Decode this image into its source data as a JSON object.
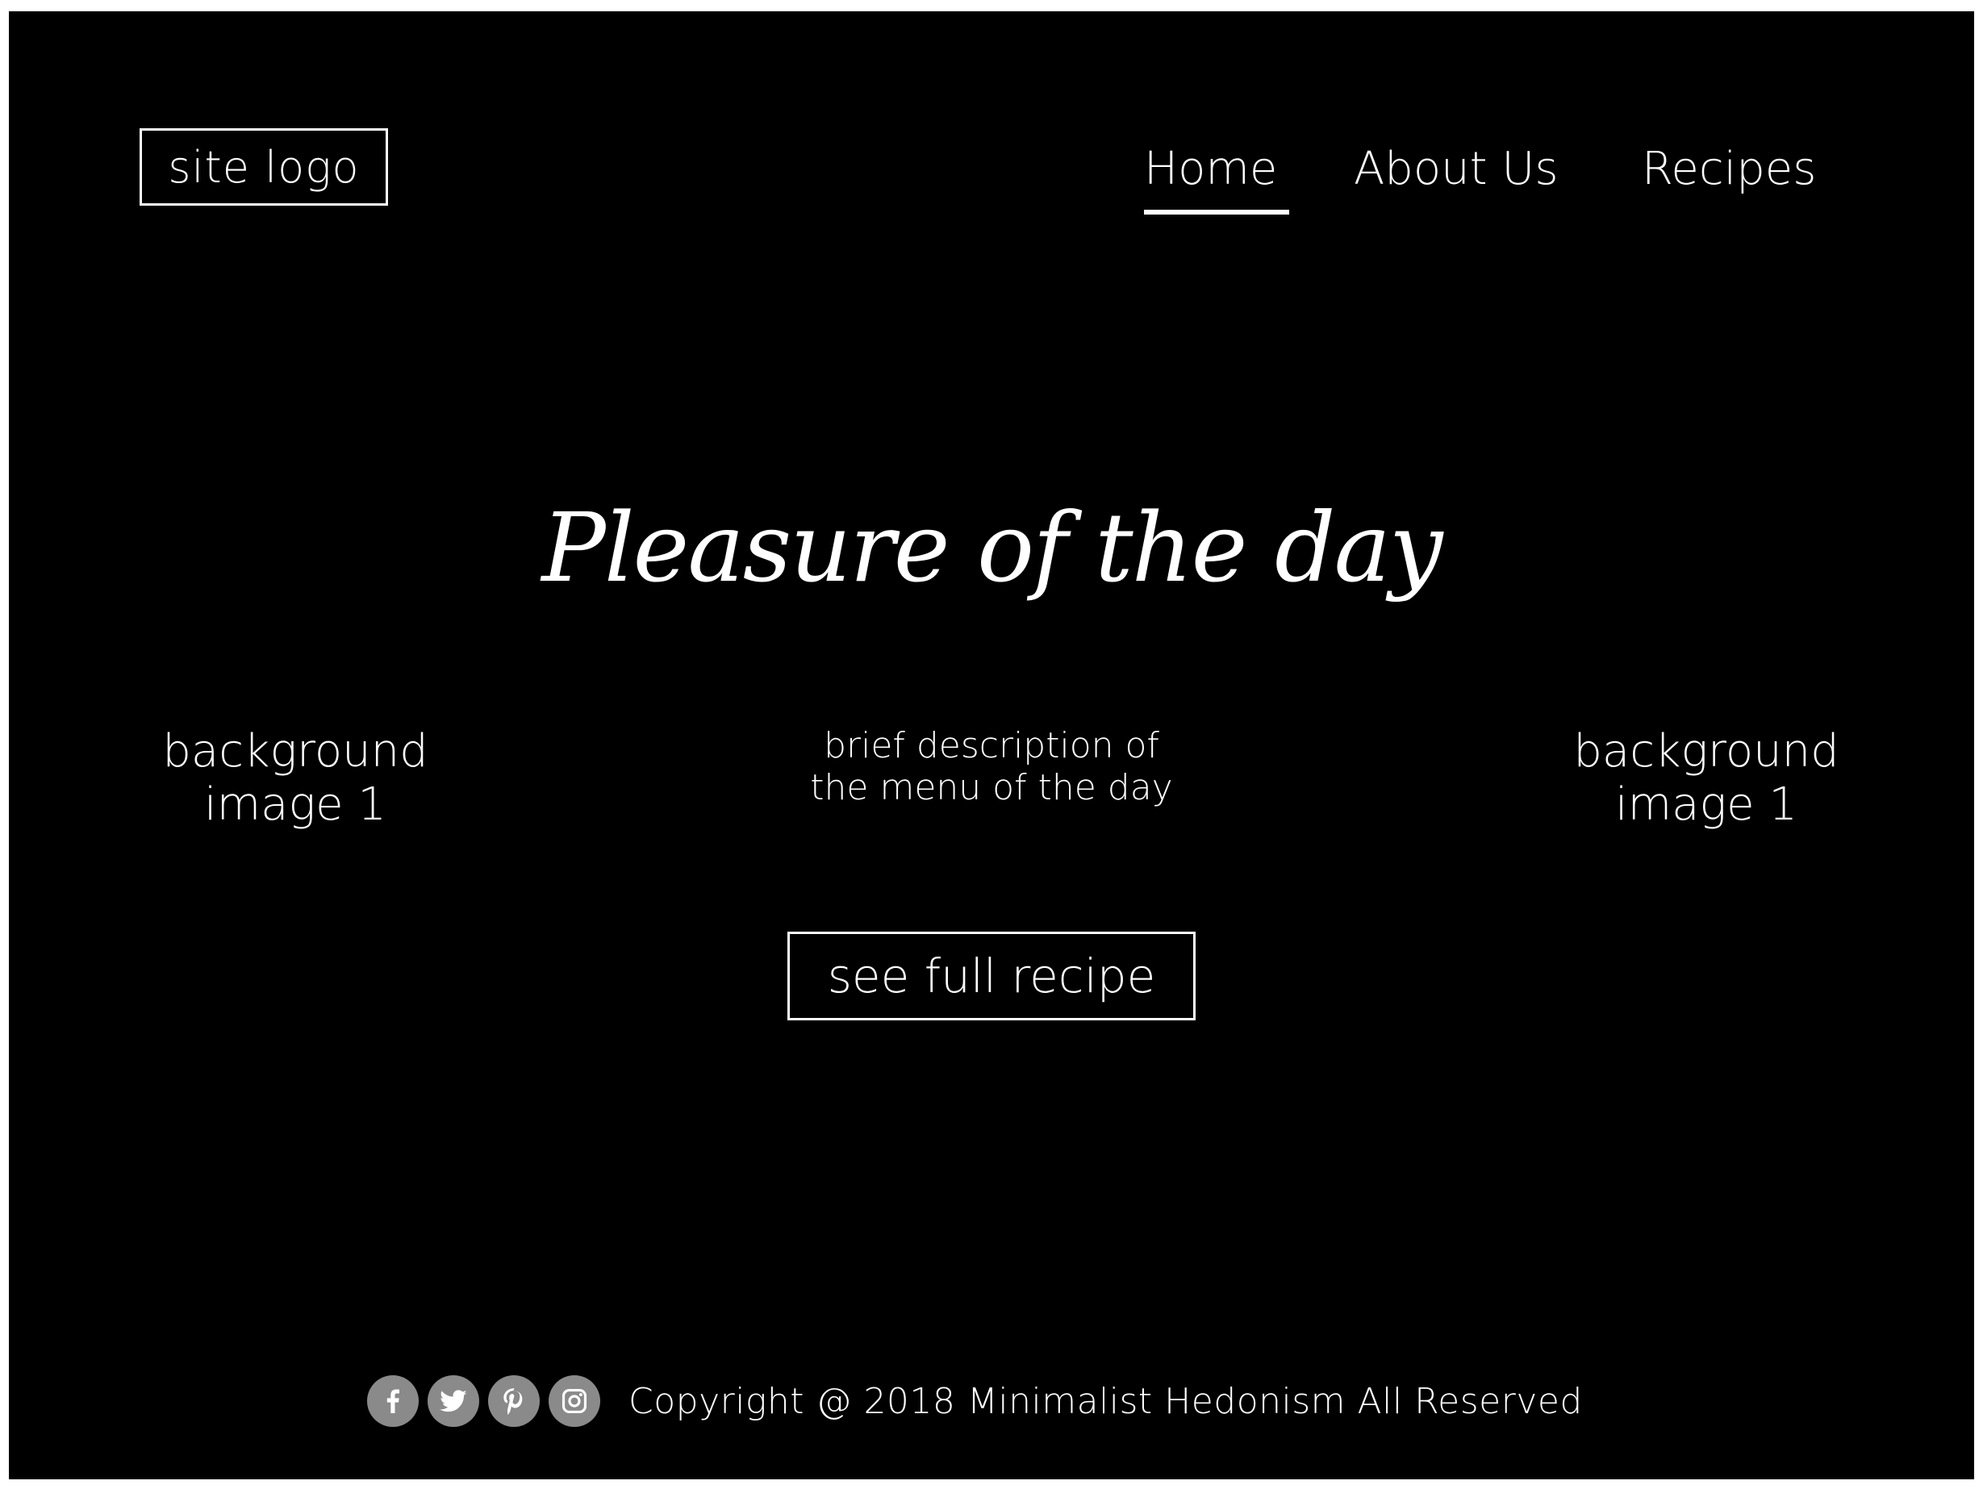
{
  "header": {
    "logo_label": "site logo",
    "nav": {
      "home": "Home",
      "about": "About Us",
      "recipes": "Recipes"
    },
    "active_nav": "home"
  },
  "hero": {
    "title": "Pleasure of the day",
    "description_line1": "brief description of",
    "description_line2": "the menu of the day",
    "left_bg_line1": "background",
    "left_bg_line2": "image 1",
    "right_bg_line1": "background",
    "right_bg_line2": "image 1",
    "cta_label": "see full recipe"
  },
  "footer": {
    "social_icons": [
      "facebook-icon",
      "twitter-icon",
      "pinterest-icon",
      "instagram-icon"
    ],
    "copyright": "Copyright @ 2018 Minimalist Hedonism All Reserved"
  },
  "colors": {
    "background": "#000000",
    "text": "#ffffff",
    "social_icon_bg": "#8a8a8a"
  }
}
